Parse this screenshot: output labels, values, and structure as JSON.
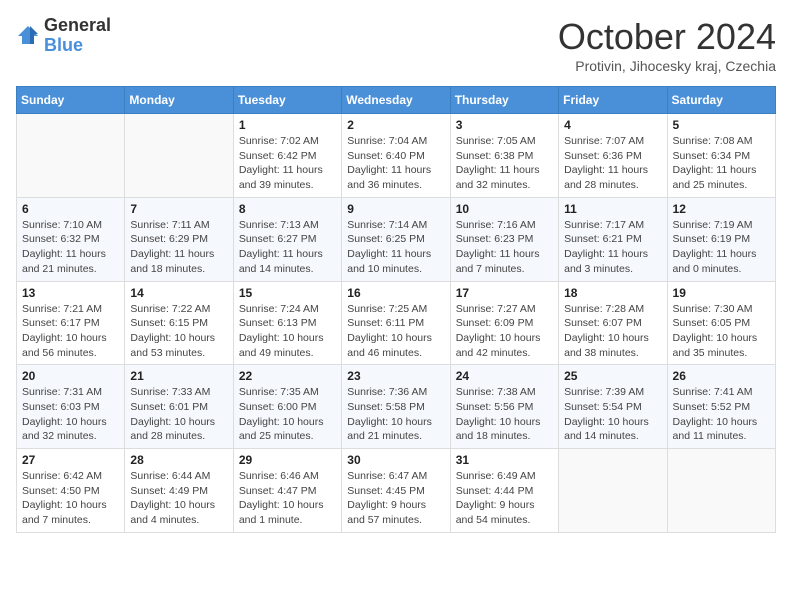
{
  "logo": {
    "general": "General",
    "blue": "Blue"
  },
  "title": "October 2024",
  "subtitle": "Protivin, Jihocesky kraj, Czechia",
  "days_header": [
    "Sunday",
    "Monday",
    "Tuesday",
    "Wednesday",
    "Thursday",
    "Friday",
    "Saturday"
  ],
  "weeks": [
    [
      {
        "day": "",
        "info": ""
      },
      {
        "day": "",
        "info": ""
      },
      {
        "day": "1",
        "info": "Sunrise: 7:02 AM\nSunset: 6:42 PM\nDaylight: 11 hours and 39 minutes."
      },
      {
        "day": "2",
        "info": "Sunrise: 7:04 AM\nSunset: 6:40 PM\nDaylight: 11 hours and 36 minutes."
      },
      {
        "day": "3",
        "info": "Sunrise: 7:05 AM\nSunset: 6:38 PM\nDaylight: 11 hours and 32 minutes."
      },
      {
        "day": "4",
        "info": "Sunrise: 7:07 AM\nSunset: 6:36 PM\nDaylight: 11 hours and 28 minutes."
      },
      {
        "day": "5",
        "info": "Sunrise: 7:08 AM\nSunset: 6:34 PM\nDaylight: 11 hours and 25 minutes."
      }
    ],
    [
      {
        "day": "6",
        "info": "Sunrise: 7:10 AM\nSunset: 6:32 PM\nDaylight: 11 hours and 21 minutes."
      },
      {
        "day": "7",
        "info": "Sunrise: 7:11 AM\nSunset: 6:29 PM\nDaylight: 11 hours and 18 minutes."
      },
      {
        "day": "8",
        "info": "Sunrise: 7:13 AM\nSunset: 6:27 PM\nDaylight: 11 hours and 14 minutes."
      },
      {
        "day": "9",
        "info": "Sunrise: 7:14 AM\nSunset: 6:25 PM\nDaylight: 11 hours and 10 minutes."
      },
      {
        "day": "10",
        "info": "Sunrise: 7:16 AM\nSunset: 6:23 PM\nDaylight: 11 hours and 7 minutes."
      },
      {
        "day": "11",
        "info": "Sunrise: 7:17 AM\nSunset: 6:21 PM\nDaylight: 11 hours and 3 minutes."
      },
      {
        "day": "12",
        "info": "Sunrise: 7:19 AM\nSunset: 6:19 PM\nDaylight: 11 hours and 0 minutes."
      }
    ],
    [
      {
        "day": "13",
        "info": "Sunrise: 7:21 AM\nSunset: 6:17 PM\nDaylight: 10 hours and 56 minutes."
      },
      {
        "day": "14",
        "info": "Sunrise: 7:22 AM\nSunset: 6:15 PM\nDaylight: 10 hours and 53 minutes."
      },
      {
        "day": "15",
        "info": "Sunrise: 7:24 AM\nSunset: 6:13 PM\nDaylight: 10 hours and 49 minutes."
      },
      {
        "day": "16",
        "info": "Sunrise: 7:25 AM\nSunset: 6:11 PM\nDaylight: 10 hours and 46 minutes."
      },
      {
        "day": "17",
        "info": "Sunrise: 7:27 AM\nSunset: 6:09 PM\nDaylight: 10 hours and 42 minutes."
      },
      {
        "day": "18",
        "info": "Sunrise: 7:28 AM\nSunset: 6:07 PM\nDaylight: 10 hours and 38 minutes."
      },
      {
        "day": "19",
        "info": "Sunrise: 7:30 AM\nSunset: 6:05 PM\nDaylight: 10 hours and 35 minutes."
      }
    ],
    [
      {
        "day": "20",
        "info": "Sunrise: 7:31 AM\nSunset: 6:03 PM\nDaylight: 10 hours and 32 minutes."
      },
      {
        "day": "21",
        "info": "Sunrise: 7:33 AM\nSunset: 6:01 PM\nDaylight: 10 hours and 28 minutes."
      },
      {
        "day": "22",
        "info": "Sunrise: 7:35 AM\nSunset: 6:00 PM\nDaylight: 10 hours and 25 minutes."
      },
      {
        "day": "23",
        "info": "Sunrise: 7:36 AM\nSunset: 5:58 PM\nDaylight: 10 hours and 21 minutes."
      },
      {
        "day": "24",
        "info": "Sunrise: 7:38 AM\nSunset: 5:56 PM\nDaylight: 10 hours and 18 minutes."
      },
      {
        "day": "25",
        "info": "Sunrise: 7:39 AM\nSunset: 5:54 PM\nDaylight: 10 hours and 14 minutes."
      },
      {
        "day": "26",
        "info": "Sunrise: 7:41 AM\nSunset: 5:52 PM\nDaylight: 10 hours and 11 minutes."
      }
    ],
    [
      {
        "day": "27",
        "info": "Sunrise: 6:42 AM\nSunset: 4:50 PM\nDaylight: 10 hours and 7 minutes."
      },
      {
        "day": "28",
        "info": "Sunrise: 6:44 AM\nSunset: 4:49 PM\nDaylight: 10 hours and 4 minutes."
      },
      {
        "day": "29",
        "info": "Sunrise: 6:46 AM\nSunset: 4:47 PM\nDaylight: 10 hours and 1 minute."
      },
      {
        "day": "30",
        "info": "Sunrise: 6:47 AM\nSunset: 4:45 PM\nDaylight: 9 hours and 57 minutes."
      },
      {
        "day": "31",
        "info": "Sunrise: 6:49 AM\nSunset: 4:44 PM\nDaylight: 9 hours and 54 minutes."
      },
      {
        "day": "",
        "info": ""
      },
      {
        "day": "",
        "info": ""
      }
    ]
  ]
}
